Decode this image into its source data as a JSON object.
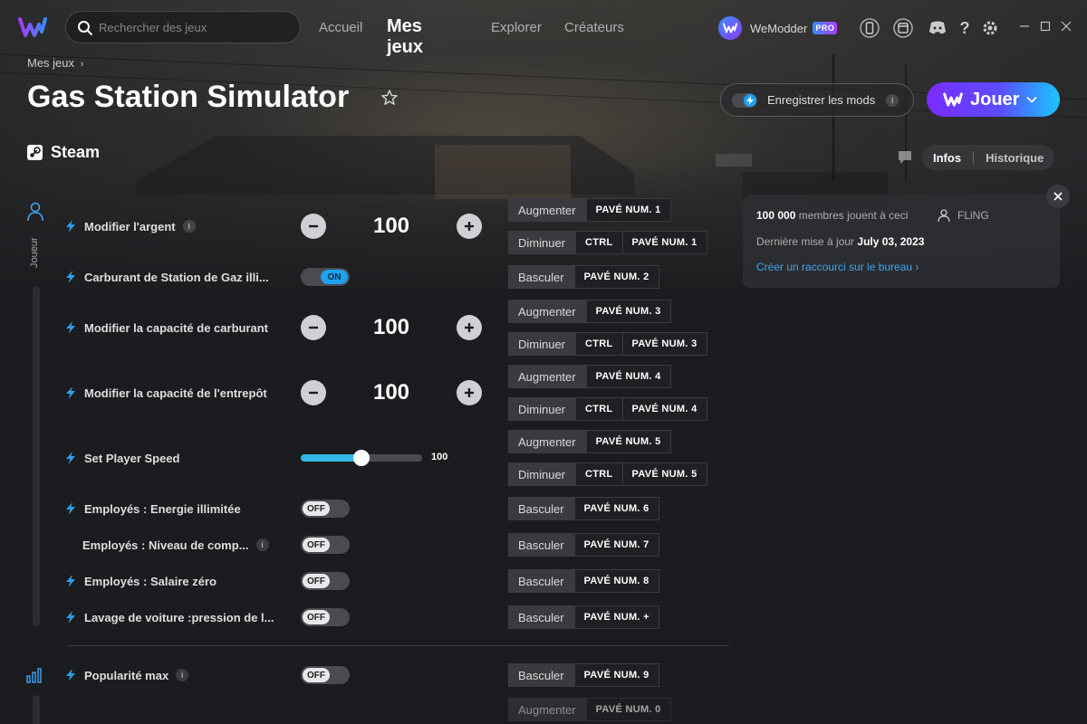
{
  "colors": {
    "accent": "#1da1f2",
    "play_gradient_start": "#7a2cff",
    "play_gradient_end": "#1ac6ff",
    "link": "#3da6f2"
  },
  "search": {
    "placeholder": "Rechercher des jeux"
  },
  "nav": {
    "home": "Accueil",
    "my_games": "Mes jeux",
    "explore": "Explorer",
    "creators": "Créateurs"
  },
  "user": {
    "name": "WeModder",
    "badge": "PRO"
  },
  "breadcrumb": "Mes jeux",
  "game": {
    "title": "Gas Station Simulator",
    "platform": "Steam"
  },
  "save_mods": {
    "label": "Enregistrer les mods",
    "enabled": true
  },
  "play": {
    "label": "Jouer"
  },
  "tabs": {
    "info": "Infos",
    "history": "Historique"
  },
  "rail": {
    "label": "Joueur"
  },
  "mods": [
    {
      "name": "Modifier l'argent",
      "control": "stepper",
      "value": "100",
      "info": true,
      "hotkeys": [
        {
          "action": "Augmenter",
          "keys": [
            "PAVÉ NUM. 1"
          ]
        },
        {
          "action": "Diminuer",
          "keys": [
            "CTRL",
            "PAVÉ NUM. 1"
          ]
        }
      ]
    },
    {
      "name": "Carburant de Station de Gaz illi...",
      "control": "toggle",
      "state": "ON",
      "hotkeys": [
        {
          "action": "Basculer",
          "keys": [
            "PAVÉ NUM. 2"
          ]
        }
      ]
    },
    {
      "name": "Modifier la capacité de carburant",
      "control": "stepper",
      "value": "100",
      "hotkeys": [
        {
          "action": "Augmenter",
          "keys": [
            "PAVÉ NUM. 3"
          ]
        },
        {
          "action": "Diminuer",
          "keys": [
            "CTRL",
            "PAVÉ NUM. 3"
          ]
        }
      ]
    },
    {
      "name": "Modifier la capacité de l'entrepôt",
      "control": "stepper",
      "value": "100",
      "hotkeys": [
        {
          "action": "Augmenter",
          "keys": [
            "PAVÉ NUM. 4"
          ]
        },
        {
          "action": "Diminuer",
          "keys": [
            "CTRL",
            "PAVÉ NUM. 4"
          ]
        }
      ]
    },
    {
      "name": "Set Player Speed",
      "control": "slider",
      "value": "100",
      "fraction": 0.5,
      "hotkeys": [
        {
          "action": "Augmenter",
          "keys": [
            "PAVÉ NUM. 5"
          ]
        },
        {
          "action": "Diminuer",
          "keys": [
            "CTRL",
            "PAVÉ NUM. 5"
          ]
        }
      ]
    },
    {
      "name": "Employés : Energie illimitée",
      "control": "toggle",
      "state": "OFF",
      "hotkeys": [
        {
          "action": "Basculer",
          "keys": [
            "PAVÉ NUM. 6"
          ]
        }
      ]
    },
    {
      "name": "Employés : Niveau de comp...",
      "control": "toggle",
      "state": "OFF",
      "info": true,
      "hotkeys": [
        {
          "action": "Basculer",
          "keys": [
            "PAVÉ NUM. 7"
          ]
        }
      ]
    },
    {
      "name": "Employés : Salaire zéro",
      "control": "toggle",
      "state": "OFF",
      "hotkeys": [
        {
          "action": "Basculer",
          "keys": [
            "PAVÉ NUM. 8"
          ]
        }
      ]
    },
    {
      "name": "Lavage de voiture :pression de l...",
      "control": "toggle",
      "state": "OFF",
      "hotkeys": [
        {
          "action": "Basculer",
          "keys": [
            "PAVÉ NUM. +"
          ]
        }
      ]
    },
    {
      "name": "Popularité max",
      "control": "toggle",
      "state": "OFF",
      "info": true,
      "hotkeys": [
        {
          "action": "Basculer",
          "keys": [
            "PAVÉ NUM. 9"
          ]
        }
      ]
    },
    {
      "name": "",
      "control": "hidden",
      "hotkeys": [
        {
          "action": "Augmenter",
          "keys": [
            "PAVÉ NUM. 0"
          ]
        }
      ]
    }
  ],
  "info_panel": {
    "members_count": "100 000",
    "members_text": "membres jouent à ceci",
    "author": "FLiNG",
    "updated_label": "Dernière mise à jour",
    "updated_date": "July 03, 2023",
    "shortcut_link": "Créer un raccourci sur le bureau"
  }
}
